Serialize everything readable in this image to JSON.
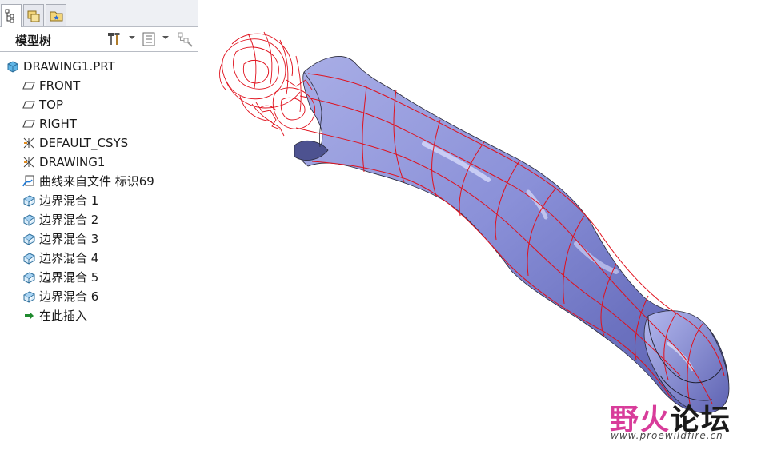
{
  "model_tree": {
    "title": "模型树",
    "root": "DRAWING1.PRT",
    "items": [
      {
        "label": "FRONT",
        "icon": "datum-plane-icon"
      },
      {
        "label": "TOP",
        "icon": "datum-plane-icon"
      },
      {
        "label": "RIGHT",
        "icon": "datum-plane-icon"
      },
      {
        "label": "DEFAULT_CSYS",
        "icon": "csys-icon"
      },
      {
        "label": "DRAWING1",
        "icon": "csys-icon"
      },
      {
        "label": "曲线来自文件 标识69",
        "icon": "curve-from-file-icon"
      },
      {
        "label": "边界混合 1",
        "icon": "boundary-blend-icon"
      },
      {
        "label": "边界混合 2",
        "icon": "boundary-blend-icon"
      },
      {
        "label": "边界混合 3",
        "icon": "boundary-blend-icon"
      },
      {
        "label": "边界混合 4",
        "icon": "boundary-blend-icon"
      },
      {
        "label": "边界混合 5",
        "icon": "boundary-blend-icon"
      },
      {
        "label": "边界混合 6",
        "icon": "boundary-blend-icon"
      },
      {
        "label": "在此插入",
        "icon": "insert-here-arrow-icon"
      }
    ]
  },
  "watermark": {
    "title_part1": "野火",
    "title_part2": "论坛",
    "url": "www.proewildfire.cn"
  },
  "colors": {
    "surface": "#8a90d6",
    "curves": "#e0101c",
    "accent": "#d83c9a"
  }
}
